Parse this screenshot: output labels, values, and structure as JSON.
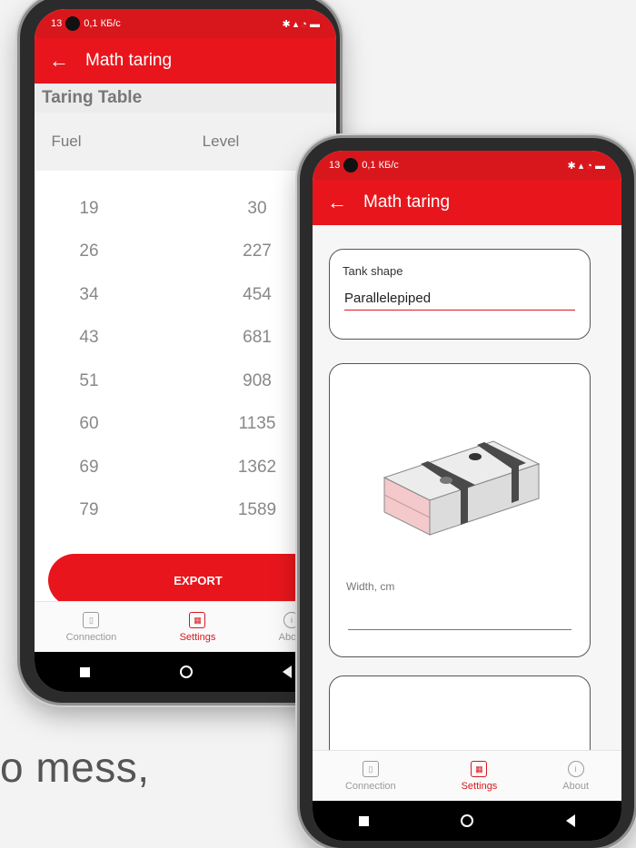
{
  "status": {
    "time": "13",
    "speed": "0,1 КБ/с"
  },
  "toolbar": {
    "title": "Math taring"
  },
  "taring": {
    "section_title": "Taring Table",
    "col_fuel": "Fuel",
    "col_level": "Level",
    "rows": [
      {
        "fuel": "19",
        "level": "30"
      },
      {
        "fuel": "26",
        "level": "227"
      },
      {
        "fuel": "34",
        "level": "454"
      },
      {
        "fuel": "43",
        "level": "681"
      },
      {
        "fuel": "51",
        "level": "908"
      },
      {
        "fuel": "60",
        "level": "1135"
      },
      {
        "fuel": "69",
        "level": "1362"
      },
      {
        "fuel": "79",
        "level": "1589"
      }
    ],
    "export_label": "EXPORT"
  },
  "form": {
    "tank_shape_label": "Tank shape",
    "tank_shape_value": "Parallelepiped",
    "width_label": "Width, cm"
  },
  "nav": {
    "connection": "Connection",
    "settings": "Settings",
    "about": "About",
    "active": "Settings"
  },
  "caption": "o mess,",
  "colors": {
    "accent": "#e8161c",
    "status": "#d8171d"
  }
}
